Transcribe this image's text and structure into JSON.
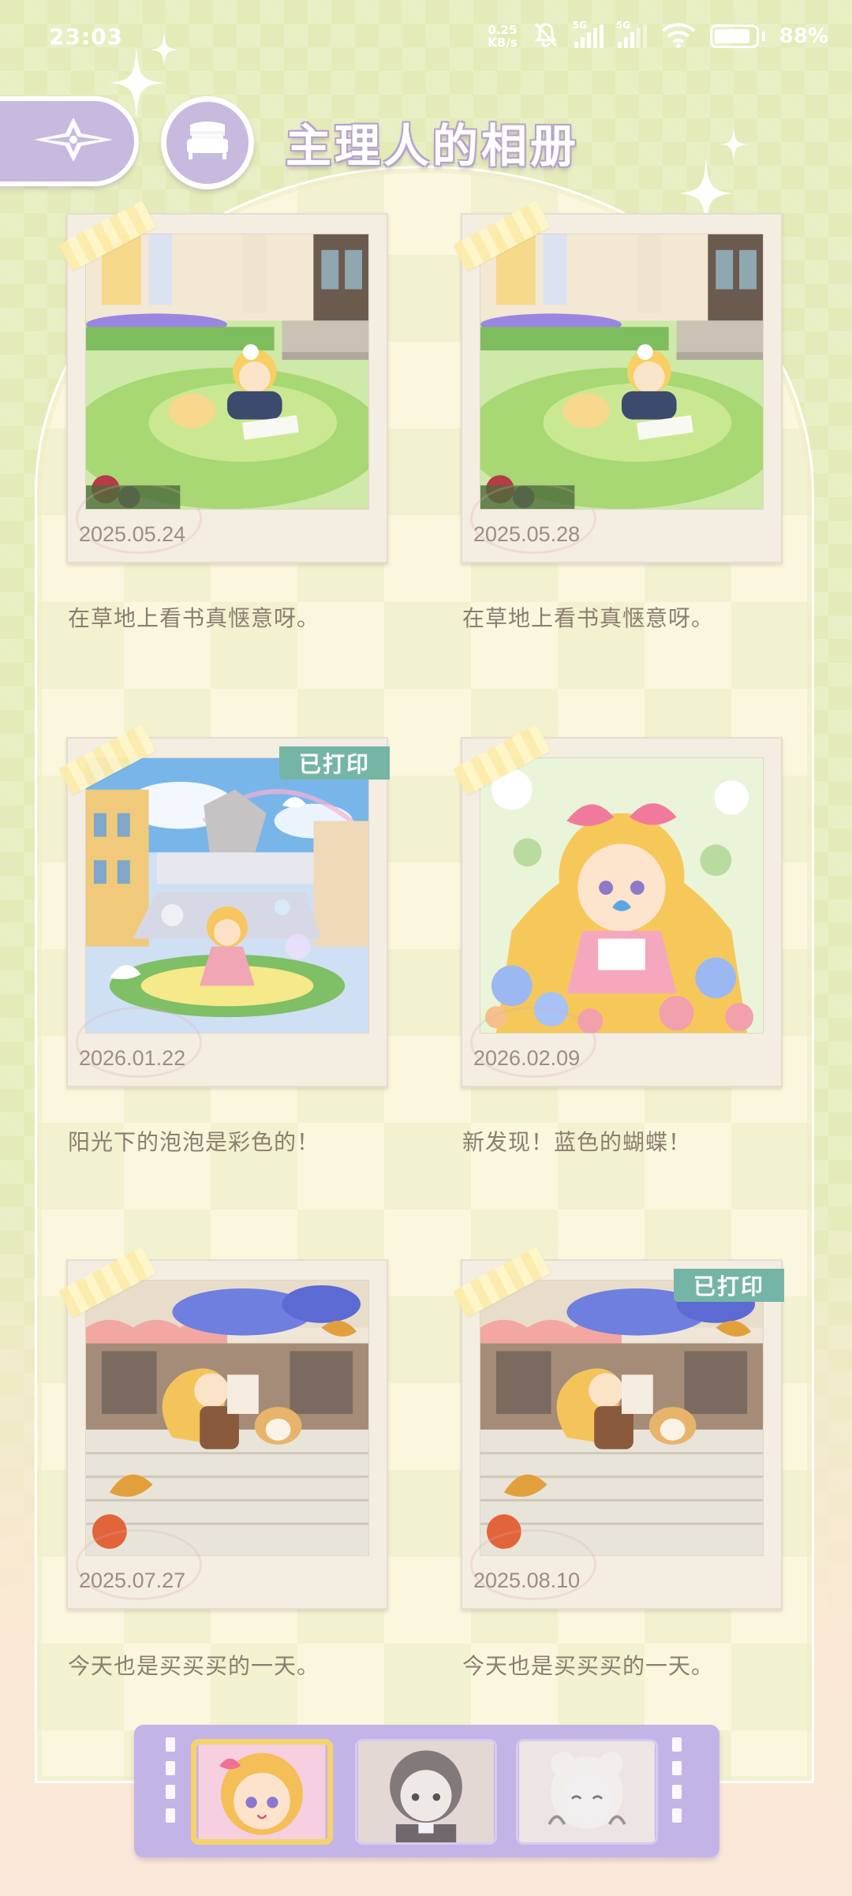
{
  "status_bar": {
    "time": "23:03",
    "net_speed_value": "0.25",
    "net_speed_unit": "KB/s",
    "signal_1": "5G",
    "signal_2": "5G",
    "battery_percent": "88%",
    "battery_level": 0.88
  },
  "header": {
    "title": "主理人的相册",
    "back_icon": "compass-arrow-icon",
    "home_icon": "bed-icon"
  },
  "photos": [
    {
      "date": "2025.05.24",
      "caption": "在草地上看书真惬意呀。",
      "printed": false,
      "scene": "garden-reading"
    },
    {
      "date": "2025.05.28",
      "caption": "在草地上看书真惬意呀。",
      "printed": false,
      "scene": "garden-reading"
    },
    {
      "date": "2026.01.22",
      "caption": "阳光下的泡泡是彩色的！",
      "printed": true,
      "badge": "已打印",
      "scene": "plaza-bubbles"
    },
    {
      "date": "2026.02.09",
      "caption": "新发现！蓝色的蝴蝶！",
      "printed": false,
      "scene": "flower-butterfly"
    },
    {
      "date": "2025.07.27",
      "caption": "今天也是买买买的一天。",
      "printed": false,
      "scene": "shopping-stairs"
    },
    {
      "date": "2025.08.10",
      "caption": "今天也是买买买的一天。",
      "printed": true,
      "badge": "已打印",
      "scene": "shopping-stairs"
    }
  ],
  "characters": [
    {
      "name": "blonde-girl",
      "active": true
    },
    {
      "name": "brown-hair-boy",
      "active": false
    },
    {
      "name": "bear-ear-girl",
      "active": false
    }
  ],
  "colors": {
    "accent_purple": "#c8b9df",
    "badge_teal": "#75b5a6",
    "panel_cream": "#fbf7de",
    "background_green": "#e4ebb8"
  }
}
